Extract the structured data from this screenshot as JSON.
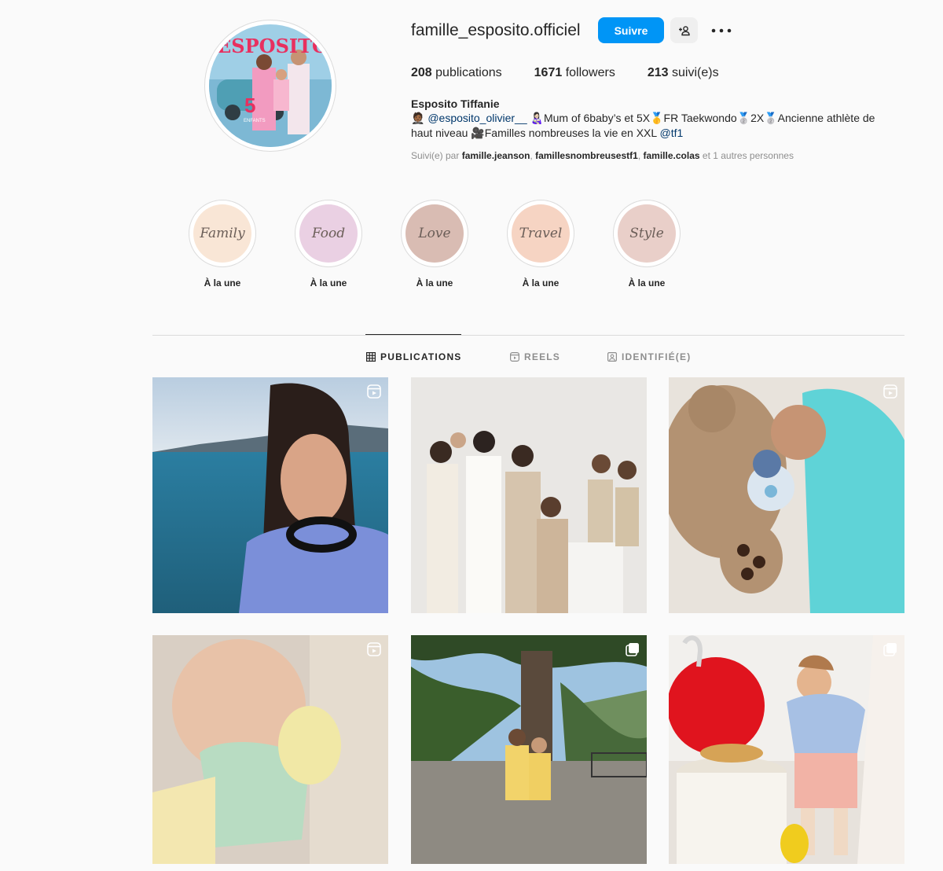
{
  "profile": {
    "username": "famille_esposito.officiel",
    "follow_label": "Suivre",
    "stats": {
      "posts_num": "208",
      "posts_label": "publications",
      "followers_num": "1671",
      "followers_label": "followers",
      "following_num": "213",
      "following_label": "suivi(e)s"
    },
    "full_name": "Esposito Tiffanie",
    "bio": {
      "mention": "@esposito_olivier__",
      "line1_text": "Mum of 6baby’s et 5X",
      "line1_text2": "FR Taekwondo",
      "line1_text3": "2X",
      "line1_text4": "Ancienne athlète de",
      "line2_text": "haut niveau",
      "line2_text2": "Familles nombreuses la vie en XXL",
      "line2_link": "@tf1",
      "emoji_man": "🤵🏾",
      "emoji_woman": "👩🏻‍🍼",
      "emoji_gold": "🥇",
      "emoji_silver": "🥈",
      "emoji_camera": "🎥"
    },
    "followed_by": {
      "prefix": "Suivi(e) par",
      "users": [
        "famille.jeanson",
        "famillesnombreusestf1",
        "famille.colas"
      ],
      "sep1": ",",
      "sep2": ",",
      "suffix": "et 1 autres personnes"
    },
    "avatar_text": "ESPOSITO",
    "avatar_number": "5",
    "avatar_subtext": "ENFANTS"
  },
  "highlights": [
    {
      "cover": "Family",
      "label": "À la une",
      "color": "#f9e6d6"
    },
    {
      "cover": "Food",
      "label": "À la une",
      "color": "#ead0e3"
    },
    {
      "cover": "Love",
      "label": "À la une",
      "color": "#d9bcb3"
    },
    {
      "cover": "Travel",
      "label": "À la une",
      "color": "#f6d4c3"
    },
    {
      "cover": "Style",
      "label": "À la une",
      "color": "#e9cfc9"
    }
  ],
  "tabs": [
    {
      "label": "PUBLICATIONS",
      "icon": "grid-icon",
      "active": true
    },
    {
      "label": "REELS",
      "icon": "reels-icon",
      "active": false
    },
    {
      "label": "IDENTIFIÉ(E)",
      "icon": "tagged-icon",
      "active": false
    }
  ],
  "posts": [
    {
      "type": "reel",
      "scene": "selfie by the sea"
    },
    {
      "type": "photo",
      "scene": "family portrait"
    },
    {
      "type": "reel",
      "scene": "baby with teddy bear"
    },
    {
      "type": "reel",
      "scene": "sleeping baby"
    },
    {
      "type": "carousel",
      "scene": "family under palm trees"
    },
    {
      "type": "carousel",
      "scene": "toddler with red balloon"
    }
  ],
  "colors": {
    "accent": "#0095f6",
    "link": "#00376b",
    "muted": "#8e8e8e",
    "text": "#262626",
    "background": "#fafafa"
  }
}
